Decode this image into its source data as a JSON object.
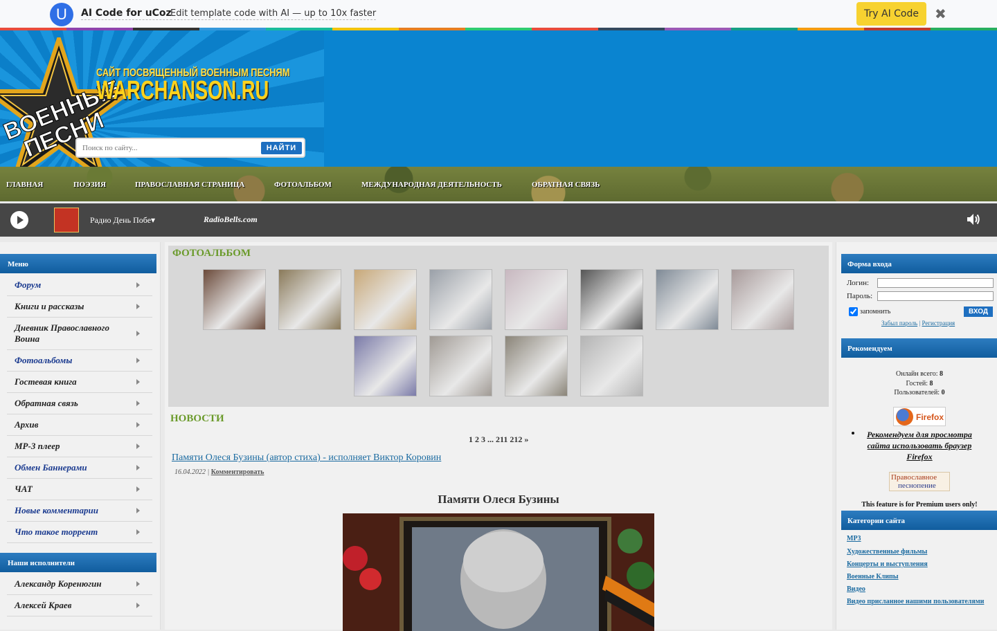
{
  "promo": {
    "logo_letter": "U",
    "title": "AI Code for uCoz",
    "text": "Edit template code with AI — up to 10x faster",
    "button": "Try AI Code",
    "close": "✖",
    "stripe_colors": [
      "#e84c3d",
      "#8e44ad",
      "#333333",
      "#3498db",
      "#1abc9c",
      "#f1c40f",
      "#e67e22",
      "#2ecc71",
      "#e84c3d",
      "#34495e",
      "#9b59b6",
      "#16a085",
      "#f39c12",
      "#c0392b",
      "#27ae60"
    ]
  },
  "header": {
    "star_text_1": "ВОЕННЫЕ",
    "star_text_2": "ПЕСНИ",
    "subtitle": "САЙТ ПОСВЯЩЕННЫЙ ВОЕННЫМ ПЕСНЯМ",
    "site_name": "WARCHANSON.RU",
    "search_placeholder": "Поиск по сайту...",
    "search_button": "НАЙТИ"
  },
  "nav": {
    "items": [
      "ГЛАВНАЯ",
      "ПОЭЗИЯ",
      "ПРАВОСЛАВНАЯ СТРАНИЦА",
      "ФОТОАЛЬБОМ",
      "МЕЖДУНАРОДНАЯ ДЕЯТЕЛЬНОСТЬ",
      "ОБРАТНАЯ СВЯЗЬ"
    ]
  },
  "player": {
    "station": "Радио День Побе▾",
    "brand": "RadioBells.com"
  },
  "left": {
    "menu_title": "Меню",
    "menu": [
      "Форум",
      "Книги и рассказы",
      "Дневник Православного Воина",
      "Фотоальбомы",
      "Гостевая книга",
      "Обратная связь",
      "Архив",
      "MP-3 плеер",
      "Обмен Баннерами",
      "ЧАТ",
      "Новые комментарии",
      "Что такое торрент"
    ],
    "performers_title": "Наши исполнители",
    "performers": [
      "Александр Коренюгин",
      "Алексей Краев"
    ]
  },
  "center": {
    "photo_title": "ФОТОАЛЬБОМ",
    "news_title": "НОВОСТИ",
    "pager": "1 2 3 ... 211 212 »",
    "news_link": "Памяти Олеся Бузины (автор стиха) - исполняет Виктор Коровин",
    "news_date": "16.04.2022 |",
    "news_comment": "Комментировать",
    "news_heading": "Памяти Олеся Бузины",
    "thumb_colors": [
      "#6b4a3a",
      "#8a7a5a",
      "#c8a878",
      "#9aa0a8",
      "#c8b8c0",
      "#555555",
      "#7f8a96",
      "#a89a9a",
      "#7a7aa8",
      "#a09a94",
      "#8a8478",
      "#b4b4b4"
    ]
  },
  "right": {
    "login_title": "Форма входа",
    "login_label": "Логин:",
    "password_label": "Пароль:",
    "remember": "запомнить",
    "login_button": "ВХОД",
    "forgot": "Забыл пароль",
    "sep": "|",
    "register": "Регистрация",
    "recommend_title": "Рекомендуем",
    "online": "Онлайн всего:",
    "online_val": "8",
    "guests": "Гостей:",
    "guests_val": "8",
    "users": "Пользователей:",
    "users_val": "0",
    "firefox_label": "Firefox",
    "firefox_rec": "Рекомендуем для просмотра сайта использовать браузер Firefox",
    "orthodox_1": "Православное",
    "orthodox_2": "песнопение",
    "premium": "This feature is for Premium users only!",
    "categories_title": "Категории сайта",
    "categories": [
      "MP3",
      "Художественные фильмы",
      "Концерты и выступления",
      "Военные Клипы",
      "Видео",
      "Видео присланное нашими пользователями"
    ]
  }
}
